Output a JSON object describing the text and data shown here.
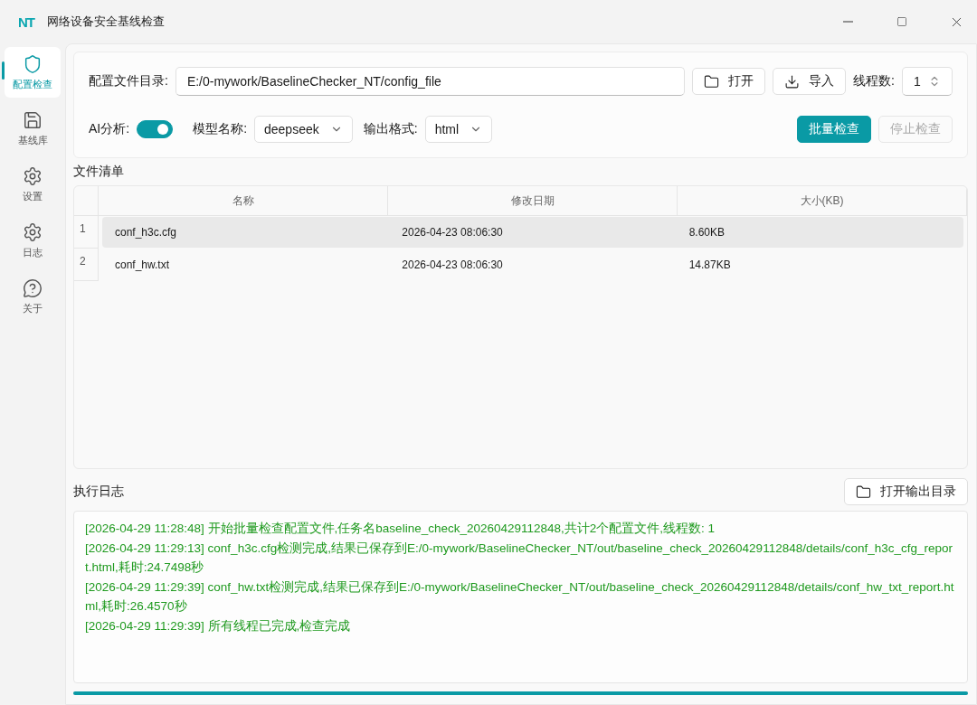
{
  "window": {
    "title": "网络设备安全基线检查",
    "logo": "NT"
  },
  "sidebar": {
    "items": [
      {
        "label": "配置检查",
        "kind": "shield",
        "selected": true
      },
      {
        "label": "基线库",
        "kind": "save",
        "selected": false
      },
      {
        "label": "设置",
        "kind": "gear",
        "selected": false
      },
      {
        "label": "日志",
        "kind": "gear",
        "selected": false
      },
      {
        "label": "关于",
        "kind": "help",
        "selected": false
      }
    ]
  },
  "config": {
    "dir_label": "配置文件目录:",
    "dir_value": "E:/0-mywork/BaselineChecker_NT/config_file",
    "open_button": "打开",
    "import_button": "导入",
    "threads_label": "线程数:",
    "threads_value": "1",
    "ai_label": "AI分析:",
    "ai_on": true,
    "model_label": "模型名称:",
    "model_value": "deepseek",
    "format_label": "输出格式:",
    "format_value": "html",
    "batch_button": "批量检查",
    "stop_button": {
      "label": "停止检查",
      "disabled": true
    }
  },
  "file_list": {
    "title": "文件清单",
    "columns": [
      "名称",
      "修改日期",
      "大小(KB)"
    ],
    "rows": [
      {
        "index": "1",
        "cells": [
          "conf_h3c.cfg",
          "2026-04-23 08:06:30",
          "8.60KB"
        ],
        "selected": true
      },
      {
        "index": "2",
        "cells": [
          "conf_hw.txt",
          "2026-04-23 08:06:30",
          "14.87KB"
        ],
        "selected": false
      }
    ]
  },
  "log": {
    "title": "执行日志",
    "open_output_button": "打开输出目录",
    "lines": [
      "[2026-04-29 11:28:48] 开始批量检查配置文件,任务名baseline_check_20260429112848,共计2个配置文件,线程数: 1",
      "[2026-04-29 11:29:13] conf_h3c.cfg检测完成,结果已保存到E:/0-mywork/BaselineChecker_NT/out/baseline_check_20260429112848/details/conf_h3c_cfg_report.html,耗时:24.7498秒",
      "[2026-04-29 11:29:39] conf_hw.txt检测完成,结果已保存到E:/0-mywork/BaselineChecker_NT/out/baseline_check_20260429112848/details/conf_hw_txt_report.html,耗时:26.4570秒",
      "[2026-04-29 11:29:39] 所有线程已完成,检查完成"
    ]
  },
  "progress": {
    "level": 1
  }
}
